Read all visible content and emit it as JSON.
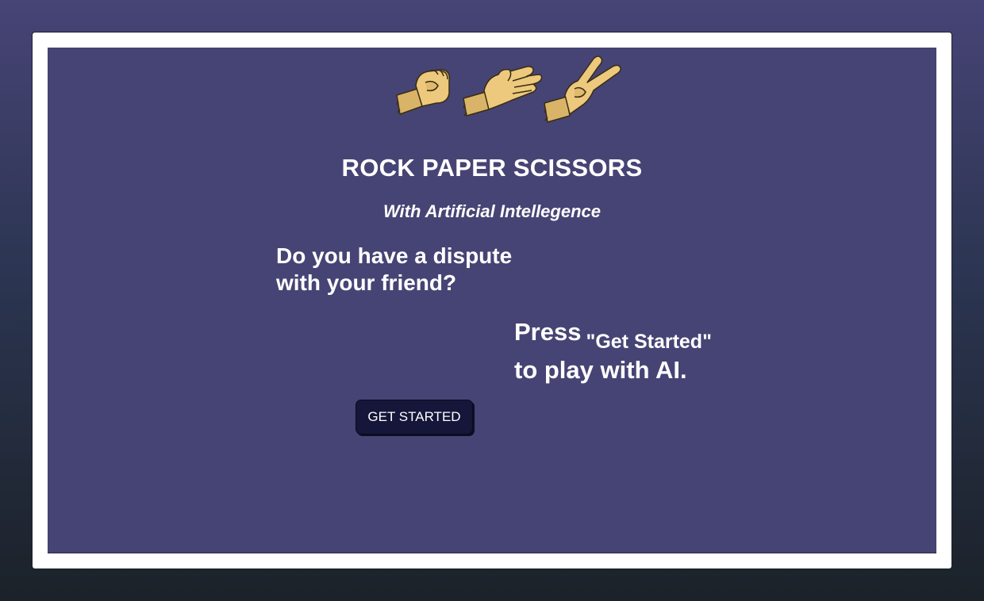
{
  "header": {
    "title": "ROCK PAPER SCISSORS",
    "subtitle": "With Artificial Intellegence"
  },
  "hands": [
    "rock-hand-icon",
    "paper-hand-icon",
    "scissors-hand-icon"
  ],
  "intro": {
    "line1": "Do you have a dispute",
    "line2": "with your friend?"
  },
  "cta": {
    "press": "Press",
    "quote": "\"Get Started\"",
    "line2": "to play with AI.",
    "button_label": "GET STARTED"
  },
  "colors": {
    "panel": "#464474",
    "frame": "#ffffff",
    "button": "#16163a",
    "hand_skin": "#e8c57a"
  }
}
